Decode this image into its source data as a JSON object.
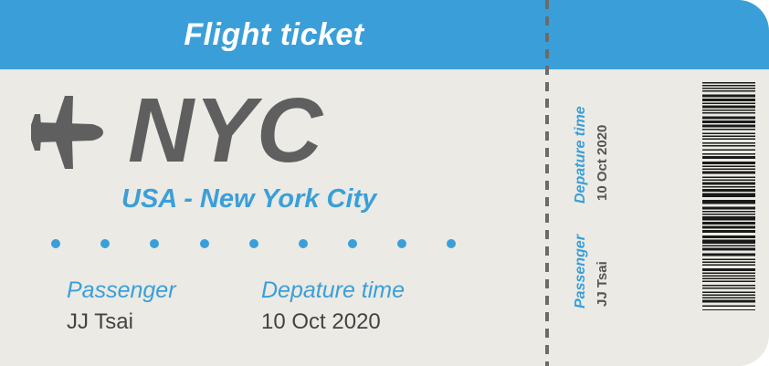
{
  "ticket": {
    "header_title": "Flight ticket",
    "destination_code": "NYC",
    "destination_name": "USA - New York City",
    "passenger_label": "Passenger",
    "passenger_name": "JJ Tsai",
    "departure_label": "Depature time",
    "departure_date": "10 Oct 2020"
  },
  "stub": {
    "departure_label": "Depature time",
    "departure_date": "10 Oct 2020",
    "passenger_label": "Passenger",
    "passenger_name": "JJ Tsai"
  },
  "icons": {
    "plane": "airplane-icon",
    "barcode": "barcode-icon"
  },
  "colors": {
    "accent_blue": "#3a9fd9",
    "ticket_background": "#ebeae4",
    "code_gray": "#5f5f5f",
    "text_dark": "#444444"
  }
}
